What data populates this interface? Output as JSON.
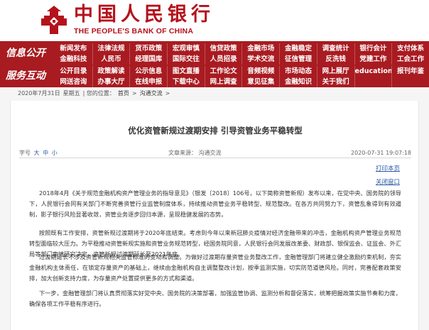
{
  "header": {
    "title_cn": "中国人民银行",
    "title_en": "THE PEOPLE'S BANK OF CHINA",
    "brand_color": "#b5121b"
  },
  "nav": {
    "bg_color": "#a81b21",
    "group1_label": "信息公开",
    "group2_label": "服务互动",
    "row1": [
      "新闻发布",
      "法律法规",
      "货币政策",
      "宏观审慎",
      "信贷政策",
      "金融市场",
      "金融稳定",
      "调查统计",
      "银行会计",
      "支付体系"
    ],
    "row2": [
      "金融科技",
      "人民币",
      "经理国库",
      "国际交往",
      "人员招录",
      "学术交流",
      "征信管理",
      "反洗钱",
      "党建工作",
      "工会工作"
    ],
    "row3": [
      "公开目录",
      "政策解读",
      "公示信息",
      "图文直播",
      "工作论文",
      "音频视频",
      "市场动态",
      "网上展厅",
      "education",
      "报刊年鉴"
    ],
    "row4": [
      "网送咨询",
      "办事大厅",
      "在线申报",
      "下载中心",
      "网上调查",
      "意见征集",
      "金融知识",
      "关于我们",
      "",
      ""
    ]
  },
  "breadcrumb": {
    "date": "2020年7月31日",
    "weekday": "星期五",
    "location_prefix": "| 您的位置：",
    "home": "首页",
    "sep1": ">",
    "section": "沟通交流",
    "sep2": ">"
  },
  "article": {
    "title": "优化资管新规过渡期安排 引导资管业务平稳转型",
    "font_size_label": "字号",
    "font_size_large": "大",
    "font_size_medium": "中",
    "font_size_small": "小",
    "source": "文章来源：  沟通交流",
    "datetime": "2020-07-31  19:07:18",
    "print_label": "打印本页",
    "close_label": "关闭窗口",
    "paragraphs": [
      "2018年4月《关于规范金融机构资产管理业务的指导意见》（银发〔2018〕106号，以下简称资管新规）发布以来，在党中央、国务院的领导下，人民银行会同有关部门不断完善资管行业监管制度体系，持续推动资管业务平稳转型、规范整改。在各方共同努力下，资管乱象得到有效遏制，影子银行风险显著收敛，资管业务逐步回归本源，呈现稳健发展的态势。",
      "按照既有工作安排，资管新规过渡期将于2020年底结束。考虑到今年以来新冠肺炎疫情对经济金融带来的冲击，金融机构资产管理业务规范转型面临较大压力。为平稳推动资管新规实施和资管业务规范转型，经国务院同意，人民银行会同发展改革委、财政部、银保监会、证监会、外汇局等部门审慎研究决定，资管新规过渡期延长至2021年底。",
      "过渡期延长不涉及资管新规相关监管标准的变动和调整。为做好过渡期存量资管业务整改工作，金融管理部门将建立健全激励约束机制，夯实金融机构主体责任，在锁定存量资产的基础上，继续由金融机构自主调整整改计划，按季监测实施，切实防范道德风险。同时，完善配套政策安排，加大创新支持力度，为存量资产处置提供更多的方式和渠道。",
      "下一步，金融管理部门将认真贯彻落实好党中央、国务院的决策部署，加强监管协调、监测分析和督促落实，统筹把握政策实施节奏和力度，确保各项工作平稳有序进行。"
    ]
  }
}
